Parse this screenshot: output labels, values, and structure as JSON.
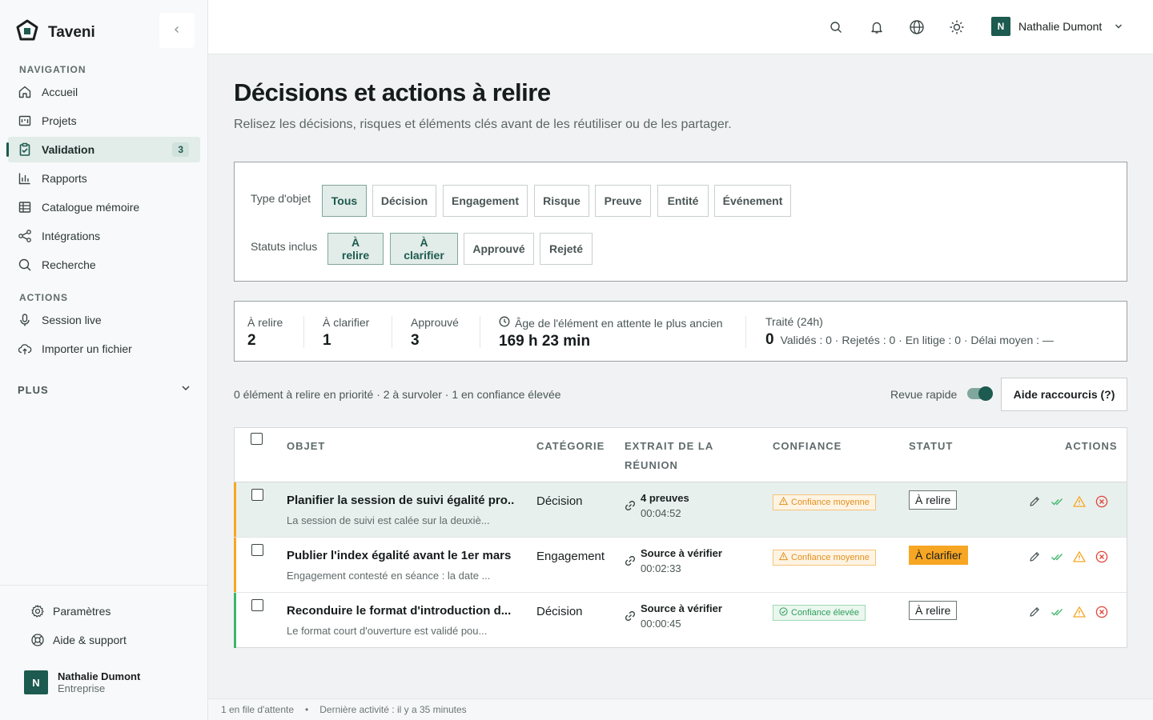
{
  "app": {
    "name": "Taveni"
  },
  "sidebar": {
    "nav_label": "NAVIGATION",
    "nav_items": [
      {
        "label": "Accueil",
        "icon": "home-icon"
      },
      {
        "label": "Projets",
        "icon": "projects-icon"
      },
      {
        "label": "Validation",
        "icon": "clipboard-check-icon",
        "badge": "3",
        "active": true
      },
      {
        "label": "Rapports",
        "icon": "bar-chart-icon"
      },
      {
        "label": "Catalogue mémoire",
        "icon": "table-icon"
      },
      {
        "label": "Intégrations",
        "icon": "share-icon"
      },
      {
        "label": "Recherche",
        "icon": "search-icon"
      }
    ],
    "actions_label": "ACTIONS",
    "action_items": [
      {
        "label": "Session live",
        "icon": "microphone-icon"
      },
      {
        "label": "Importer un fichier",
        "icon": "cloud-upload-icon"
      }
    ],
    "plus_label": "PLUS",
    "bottom_items": [
      {
        "label": "Paramètres",
        "icon": "gear-icon"
      },
      {
        "label": "Aide & support",
        "icon": "lifebuoy-icon"
      }
    ],
    "user": {
      "initial": "N",
      "name": "Nathalie Dumont",
      "plan": "Entreprise"
    }
  },
  "header": {
    "user_initial": "N",
    "user_name": "Nathalie Dumont"
  },
  "page": {
    "title": "Décisions et actions à relire",
    "subtitle": "Relisez les décisions, risques et éléments clés avant de les réutiliser ou de les partager."
  },
  "filters": {
    "type_label": "Type d'objet",
    "types": [
      {
        "label": "Tous",
        "active": true
      },
      {
        "label": "Décision",
        "active": false
      },
      {
        "label": "Engagement",
        "active": false
      },
      {
        "label": "Risque",
        "active": false
      },
      {
        "label": "Preuve",
        "active": false
      },
      {
        "label": "Entité",
        "active": false
      },
      {
        "label": "Événement",
        "active": false
      }
    ],
    "status_label": "Statuts inclus",
    "statuses": [
      {
        "label": "À relire",
        "active": true
      },
      {
        "label": "À clarifier",
        "active": true
      },
      {
        "label": "Approuvé",
        "active": false
      },
      {
        "label": "Rejeté",
        "active": false
      }
    ]
  },
  "stats": {
    "a_relire": {
      "label": "À relire",
      "value": "2"
    },
    "a_clarifier": {
      "label": "À clarifier",
      "value": "1"
    },
    "approuve": {
      "label": "Approuvé",
      "value": "3"
    },
    "oldest": {
      "label": "Âge de l'élément en attente le plus ancien",
      "value": "169 h 23 min"
    },
    "traite": {
      "label": "Traité (24h)",
      "value": "0",
      "detail": "Validés : 0 · Rejetés : 0 · En litige : 0 · Délai moyen : —"
    }
  },
  "toolbar": {
    "summary": "0 élément à relire en priorité · 2 à survoler · 1 en confiance élevée",
    "quick_review_label": "Revue rapide",
    "quick_review_on": true,
    "help_label": "Aide raccourcis (?)"
  },
  "table": {
    "headers": {
      "objet": "OBJET",
      "categorie": "CATÉGORIE",
      "extrait_1": "EXTRAIT DE LA",
      "extrait_2": "RÉUNION",
      "confiance": "CONFIANCE",
      "statut": "STATUT",
      "actions": "ACTIONS"
    },
    "rows": [
      {
        "title": "Planifier la session de suivi égalité pro...",
        "desc": "La session de suivi est calée sur la deuxiè...",
        "category": "Décision",
        "extract_main": "4 preuves",
        "extract_time": "00:04:52",
        "confidence": "Confiance moyenne",
        "confidence_level": "mid",
        "status": "À relire",
        "accent": "#f7a623"
      },
      {
        "title": "Publier l'index égalité avant le 1er mars",
        "desc": "Engagement contesté en séance : la date ...",
        "category": "Engagement",
        "extract_main": "Source à vérifier",
        "extract_time": "00:02:33",
        "confidence": "Confiance moyenne",
        "confidence_level": "mid",
        "status": "À clarifier",
        "accent": "#f7a623"
      },
      {
        "title": "Reconduire le format d'introduction d...",
        "desc": "Le format court d'ouverture est validé pou...",
        "category": "Décision",
        "extract_main": "Source à vérifier",
        "extract_time": "00:00:45",
        "confidence": "Confiance élevée",
        "confidence_level": "high",
        "status": "À relire",
        "accent": "#3fb56b"
      }
    ]
  },
  "footer": {
    "queue": "1 en file d'attente",
    "activity": "Dernière activité : il y a 35 minutes"
  },
  "colors": {
    "brand": "#1d5a4f",
    "warn": "#f7a623",
    "success": "#3fb56b",
    "danger": "#e0453a"
  }
}
